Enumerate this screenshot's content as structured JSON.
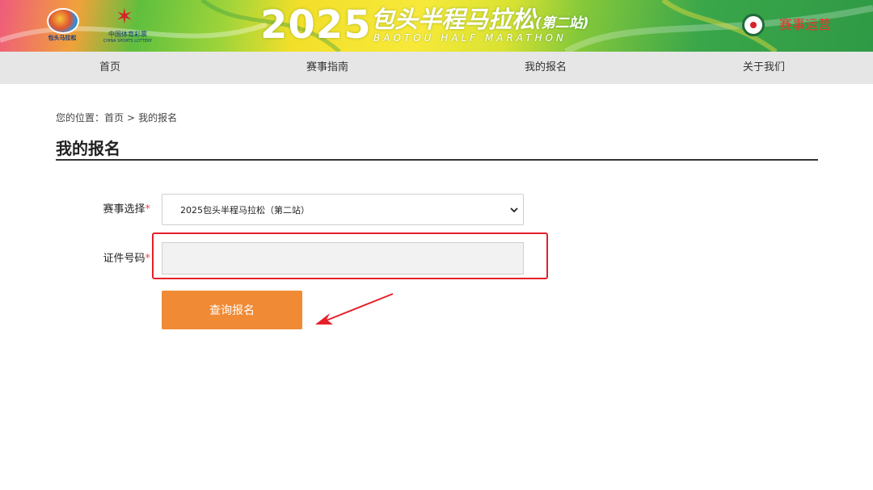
{
  "banner": {
    "year": "2025",
    "title": "包头半程马拉松",
    "stage": "(第二站)",
    "subtitle_en": "BAOTOU HALF MARATHON",
    "left_logo_caption": "包头马拉松",
    "lottery_caption": "中国体育彩票",
    "lottery_caption_en": "CHINA SPORTS LOTTERY",
    "right_logo_text": "赛事运营",
    "colors": {
      "accent_green": "#2f9a45",
      "accent_yellow": "#f3df2a",
      "title_white": "#ffffff"
    }
  },
  "nav": {
    "items": [
      {
        "label": "首页"
      },
      {
        "label": "赛事指南"
      },
      {
        "label": "我的报名"
      },
      {
        "label": "关于我们"
      }
    ]
  },
  "breadcrumb": {
    "prefix": "您的位置：",
    "home": "首页",
    "separator": ">",
    "current": "我的报名"
  },
  "page": {
    "title": "我的报名"
  },
  "form": {
    "event_label": "赛事选择",
    "event_value": "2025包头半程马拉松（第二站）",
    "id_label": "证件号码",
    "id_value": "",
    "required_mark": "*",
    "submit_label": "查询报名",
    "colors": {
      "button": "#f08a35",
      "highlight": "#e5202a",
      "required": "#e84a4a"
    }
  },
  "annotation": {
    "icon": "arrow-pointer-icon"
  }
}
